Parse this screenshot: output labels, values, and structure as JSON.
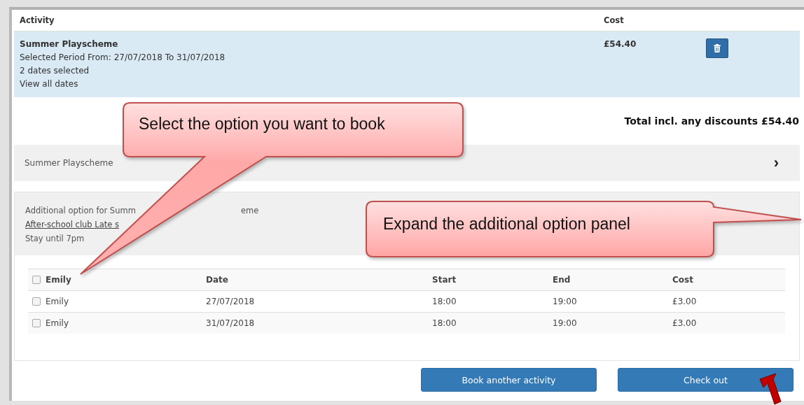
{
  "cart": {
    "columns": [
      "Activity",
      "Cost"
    ],
    "item": {
      "title": "Summer Playscheme",
      "period": "Selected Period From: 27/07/2018 To 31/07/2018",
      "dates": "2 dates selected",
      "view_link": "View all dates",
      "cost": "£54.40"
    },
    "total": "Total incl. any discounts £54.40"
  },
  "panels": [
    {
      "kind": "collapsed",
      "title": "Summer Playscheme",
      "chevron": "›"
    },
    {
      "kind": "expanded",
      "caption_parts": [
        "Additional option for Summ",
        "eme"
      ],
      "link": "After-school club Late s",
      "note": "Stay until 7pm",
      "table": {
        "header": {
          "checked": false,
          "columns": [
            "Emily",
            "Date",
            "Start",
            "End",
            "Cost"
          ]
        },
        "rows": [
          {
            "checked": false,
            "cells": [
              "Emily",
              "27/07/2018",
              "18:00",
              "19:00",
              "£3.00"
            ]
          },
          {
            "checked": false,
            "cells": [
              "Emily",
              "31/07/2018",
              "18:00",
              "19:00",
              "£3.00"
            ]
          }
        ]
      }
    }
  ],
  "buttons": [
    "Book another activity",
    "Check out"
  ],
  "callouts": [
    {
      "text": "Select the option you want to book"
    },
    {
      "text": "Expand the additional option panel"
    }
  ]
}
